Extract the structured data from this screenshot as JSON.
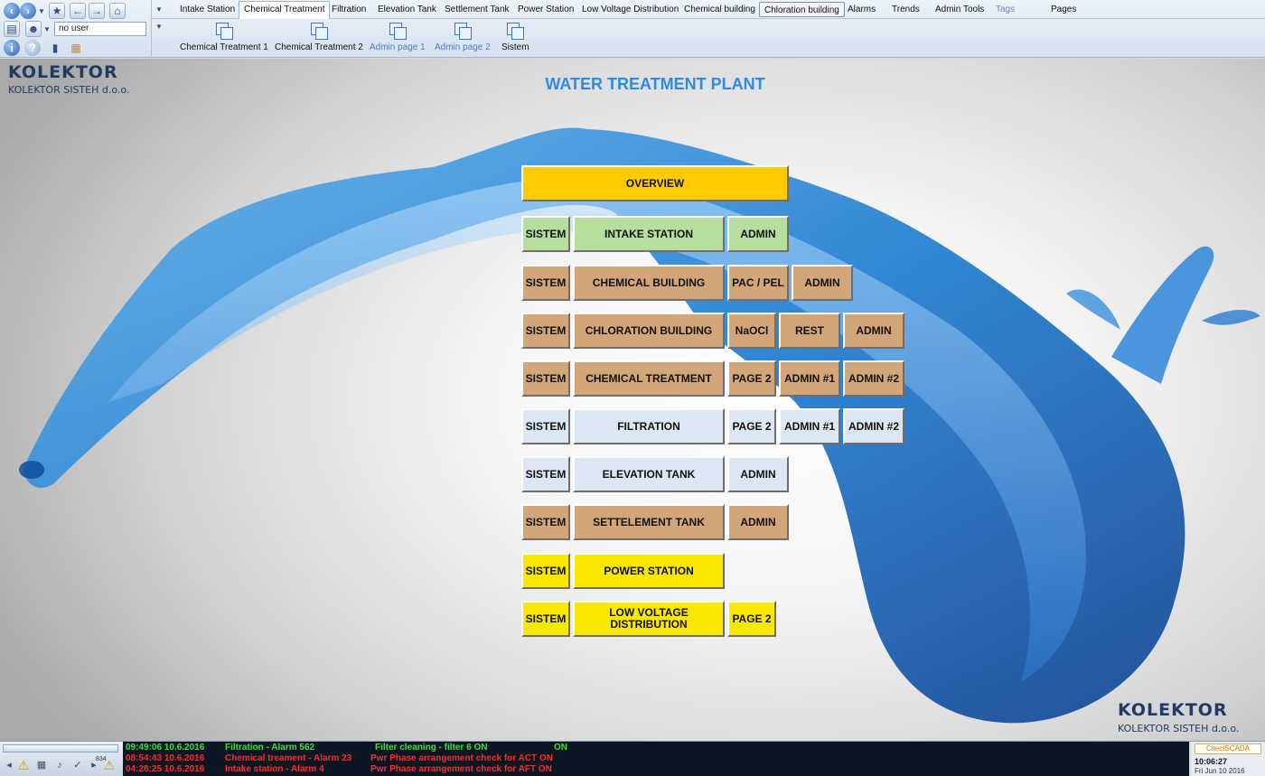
{
  "user": {
    "value": "no user"
  },
  "tabs": [
    {
      "label": "Intake Station"
    },
    {
      "label": "Chemical Treatment"
    },
    {
      "label": "Filtration"
    },
    {
      "label": "Elevation Tank"
    },
    {
      "label": "Settlement Tank"
    },
    {
      "label": "Power Station"
    },
    {
      "label": "Low Voltage Distribution"
    },
    {
      "label": "Chemical building"
    },
    {
      "label": "Chloration building"
    },
    {
      "label": "Alarms"
    },
    {
      "label": "Trends"
    },
    {
      "label": "Admin Tools"
    },
    {
      "label": "Tags"
    },
    {
      "label": "Pages"
    }
  ],
  "subpages": [
    {
      "label": "Chemical Treatment 1"
    },
    {
      "label": "Chemical Treatment 2"
    },
    {
      "label": "Admin page 1"
    },
    {
      "label": "Admin page 2"
    },
    {
      "label": "Sistem"
    }
  ],
  "brand": {
    "name": "KOLEKTOR",
    "company": "KOLEKTOR SISTEH d.o.o."
  },
  "title": "WATER TREATMENT PLANT",
  "overview": "OVERVIEW",
  "rows": {
    "intake": {
      "sistem": "SISTEM",
      "main": "INTAKE STATION",
      "b1": "ADMIN"
    },
    "chembuild": {
      "sistem": "SISTEM",
      "main": "CHEMICAL BUILDING",
      "b1": "PAC / PEL",
      "b2": "ADMIN"
    },
    "chlor": {
      "sistem": "SISTEM",
      "main": "CHLORATION BUILDING",
      "b1": "NaOCl",
      "b2": "REST",
      "b3": "ADMIN"
    },
    "chemtreat": {
      "sistem": "SISTEM",
      "main": "CHEMICAL TREATMENT",
      "b1": "PAGE 2",
      "b2": "ADMIN #1",
      "b3": "ADMIN #2"
    },
    "filtration": {
      "sistem": "SISTEM",
      "main": "FILTRATION",
      "b1": "PAGE 2",
      "b2": "ADMIN #1",
      "b3": "ADMIN #2"
    },
    "elevation": {
      "sistem": "SISTEM",
      "main": "ELEVATION TANK",
      "b1": "ADMIN"
    },
    "settlement": {
      "sistem": "SISTEM",
      "main": "SETTELEMENT TANK",
      "b1": "ADMIN"
    },
    "power": {
      "sistem": "SISTEM",
      "main": "POWER STATION"
    },
    "lowvolt": {
      "sistem": "SISTEM",
      "main": "LOW VOLTAGE DISTRIBUTION",
      "b1": "PAGE 2"
    }
  },
  "alarms": [
    {
      "datetime": "09:49:06 10.6.2016",
      "source": "Filtration - Alarm 562",
      "desc": "Filter cleaning - filter 6 ON",
      "state": "ON",
      "color": "#3ce03c"
    },
    {
      "datetime": "08:54:43 10.6.2016",
      "source": "Chemical treament - Alarm 23",
      "desc": "Pwr Phase arrangement check for ACT ON",
      "state": "",
      "color": "#ff2a2a"
    },
    {
      "datetime": "04:28:25 10.6.2016",
      "source": "Intake station - Alarm 4",
      "desc": "Pwr Phase arrangement check for AFT ON",
      "state": "",
      "color": "#ff2a2a"
    }
  ],
  "alarm_count": "834",
  "status": {
    "product": "CitectSCADA",
    "time": "10:06:27",
    "date": "Fri Jun 10 2016"
  },
  "colors": {
    "overview": "#fdcb00",
    "intake": "#b6df9e",
    "building": "#d2a679",
    "process": "#dde7f3",
    "power": "#f8e800",
    "title": "#2f8be0"
  },
  "icons": [
    "back-icon",
    "forward-icon",
    "bookmark-icon",
    "prev-page-icon",
    "next-page-icon",
    "home-icon",
    "print-icon",
    "user-login-icon",
    "info-icon",
    "help-icon",
    "battery-icon",
    "notes-icon",
    "page-icon",
    "warning-icon"
  ]
}
